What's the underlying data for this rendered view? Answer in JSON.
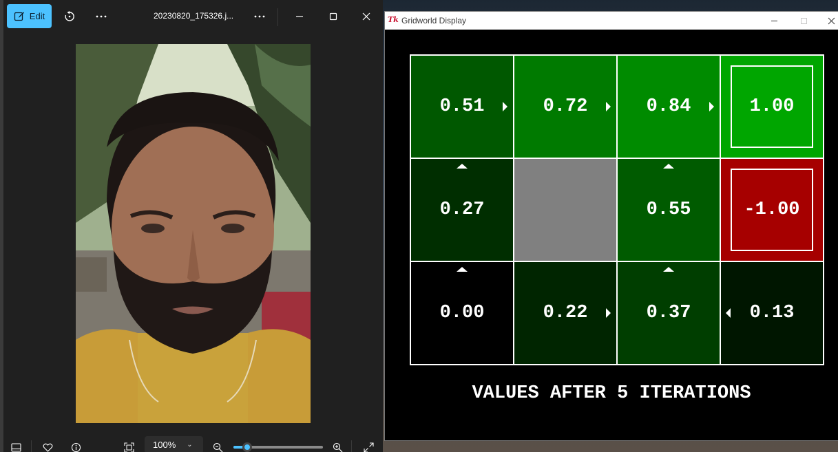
{
  "photos": {
    "edit_label": "Edit",
    "file_name": "20230820_175326.j...",
    "zoom": {
      "value_label": "100%",
      "slider_level": 0.15
    },
    "icons": [
      "edit-icon",
      "rotate-icon",
      "more-icon",
      "minimize-icon",
      "maximize-icon",
      "close-icon",
      "filmstrip-icon",
      "heart-icon",
      "info-icon",
      "fit-to-window-icon",
      "zoom-out-icon",
      "zoom-in-icon",
      "fullscreen-icon"
    ]
  },
  "gridworld": {
    "window_title": "Gridworld Display",
    "tk_icon_label": "Tk",
    "caption": "VALUES AFTER 5 ITERATIONS",
    "cells": [
      {
        "value": "0.51",
        "color": "#005800",
        "arrow": "right",
        "terminal": false
      },
      {
        "value": "0.72",
        "color": "#007a00",
        "arrow": "right",
        "terminal": false
      },
      {
        "value": "0.84",
        "color": "#008b00",
        "arrow": "right",
        "terminal": false
      },
      {
        "value": "1.00",
        "color": "#00a600",
        "arrow": "none",
        "terminal": true
      },
      {
        "value": "0.27",
        "color": "#002e00",
        "arrow": "up",
        "terminal": false
      },
      {
        "value": "",
        "color": "#808080",
        "arrow": "none",
        "terminal": false,
        "wall": true
      },
      {
        "value": "0.55",
        "color": "#005b00",
        "arrow": "up",
        "terminal": false
      },
      {
        "value": "-1.00",
        "color": "#a60000",
        "arrow": "none",
        "terminal": true
      },
      {
        "value": "0.00",
        "color": "#000000",
        "arrow": "up",
        "terminal": false
      },
      {
        "value": "0.22",
        "color": "#002500",
        "arrow": "right",
        "terminal": false
      },
      {
        "value": "0.37",
        "color": "#003e00",
        "arrow": "up",
        "terminal": false
      },
      {
        "value": "0.13",
        "color": "#001600",
        "arrow": "left",
        "terminal": false
      }
    ]
  }
}
